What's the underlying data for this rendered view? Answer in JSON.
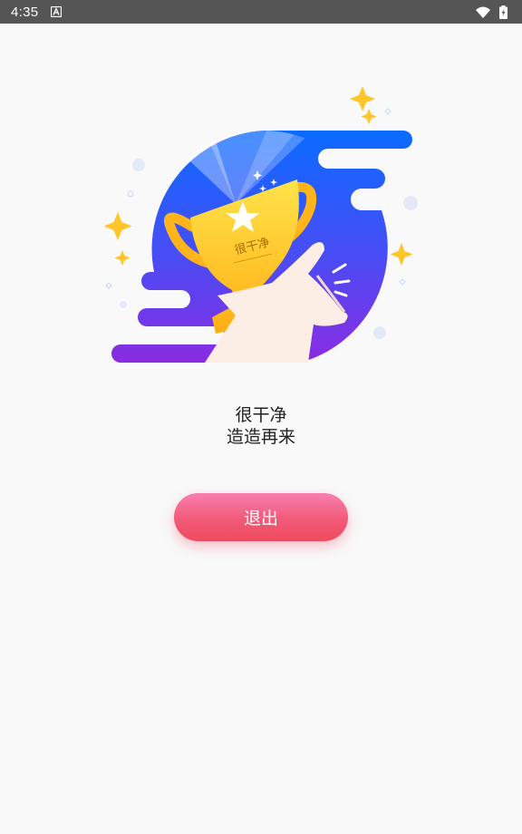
{
  "status_bar": {
    "time": "4:35",
    "icons": [
      "notification-a-icon",
      "wifi-icon",
      "battery-charging-icon"
    ]
  },
  "illustration": {
    "subject": "trophy-in-hand-icon",
    "trophy_engraving": "很干净",
    "colors": {
      "gradient_top": "#0a6bff",
      "gradient_bottom": "#8a2be2",
      "trophy": "#ffc21a",
      "sparkle": "#ffc52a",
      "hand": "#fdeee5"
    }
  },
  "message": {
    "line1": "很干净",
    "line2": "造造再来"
  },
  "exit_button": {
    "label": "退出",
    "colors": {
      "top": "#f77fb0",
      "bottom": "#ef4a5e"
    }
  }
}
